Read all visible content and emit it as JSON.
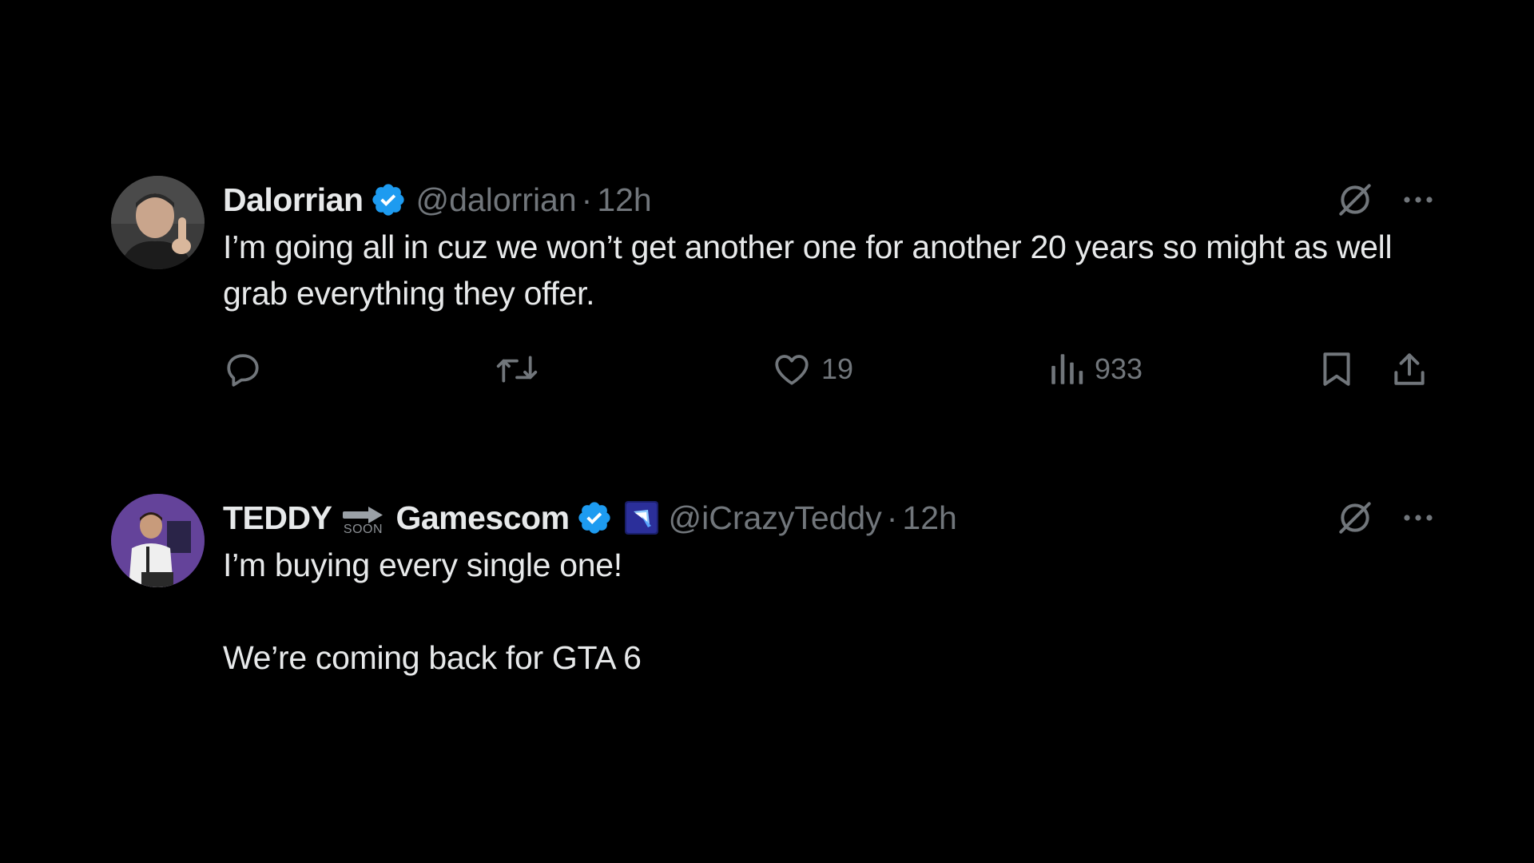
{
  "tweets": [
    {
      "display_name": "Dalorrian",
      "handle": "@dalorrian",
      "separator": "·",
      "time": "12h",
      "text": "I’m going all in cuz we won’t get another one for another 20 years so might as well grab everything they offer.",
      "likes": "19",
      "views": "933",
      "icons": [
        "avatar",
        "verified-badge-icon",
        "grok-icon",
        "more-icon",
        "reply-icon",
        "retweet-icon",
        "like-icon",
        "views-icon",
        "bookmark-icon",
        "share-icon"
      ]
    },
    {
      "display_name_prefix": "TEDDY",
      "soon_label": "SOON",
      "display_name_suffix": "Gamescom",
      "handle": "@iCrazyTeddy",
      "separator": "·",
      "time": "12h",
      "text": "I’m buying every single one!\n\nWe’re coming back for GTA 6",
      "icons": [
        "avatar",
        "arrow-right-icon",
        "verified-badge-icon",
        "affiliate-app-icon",
        "grok-icon",
        "more-icon"
      ]
    }
  ],
  "colors": {
    "background": "#000000",
    "text_primary": "#e7e9ea",
    "text_secondary": "#71767b",
    "verified_blue": "#1d9bf0"
  }
}
